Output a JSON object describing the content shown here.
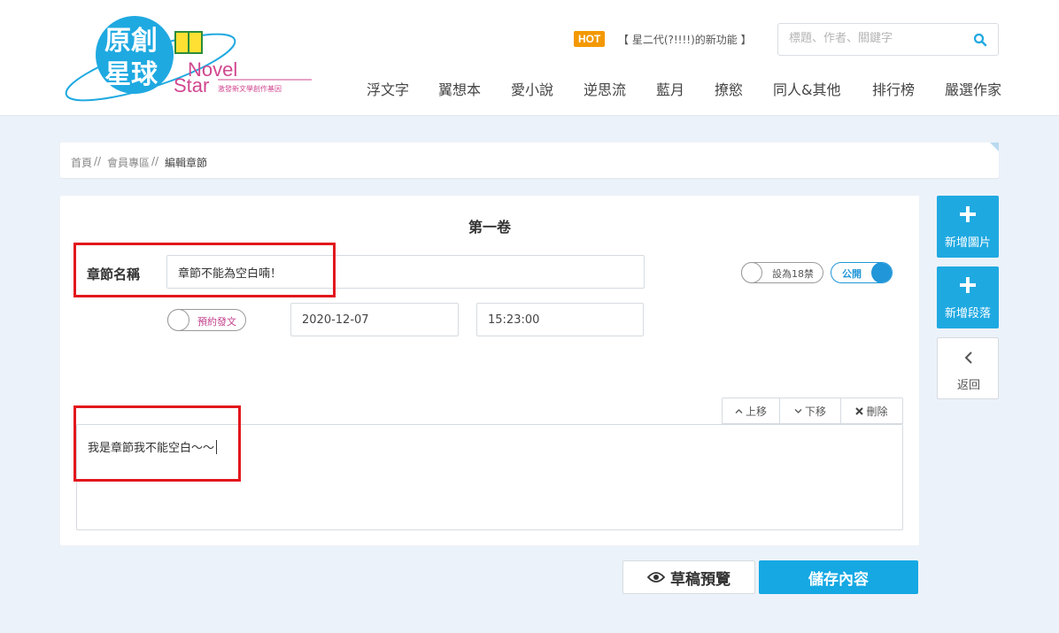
{
  "brand": {
    "logo_text_cn": "原創星球",
    "logo_text_en1": "Novel",
    "logo_text_en2": "Star",
    "tagline": "激發新文學創作基因",
    "colors": {
      "primary": "#1fa9e1",
      "accent_pink": "#c2408c",
      "hot_orange": "#f39800"
    }
  },
  "header": {
    "hot_badge": "HOT",
    "hot_news": "【 星二代(?!!!!)的新功能 】",
    "search": {
      "placeholder": "標題、作者、關鍵字",
      "icon": "search-icon"
    },
    "nav": [
      "浮文字",
      "翼想本",
      "愛小說",
      "逆思流",
      "藍月",
      "撩慾",
      "同人&其他",
      "排行榜",
      "嚴選作家"
    ]
  },
  "breadcrumb": {
    "home": "首頁",
    "sep": "//",
    "member": "會員專區",
    "current": "編輯章節"
  },
  "editor": {
    "volume_title": "第一卷",
    "chapter_label": "章節名稱",
    "chapter_title_value": "章節不能為空白喃！",
    "toggle_r18": "設為18禁",
    "toggle_public": "公開",
    "toggle_schedule": "預約發文",
    "date_value": "2020-12-07",
    "time_value": "15:23:00",
    "para_tools": {
      "up": "上移",
      "down": "下移",
      "delete": "刪除"
    },
    "content_text": "我是章節我不能空白～～"
  },
  "sidebar": {
    "add_image": "新增圖片",
    "add_paragraph": "新增段落",
    "back": "返回"
  },
  "footer_actions": {
    "preview": "草稿預覽",
    "save": "儲存內容"
  }
}
